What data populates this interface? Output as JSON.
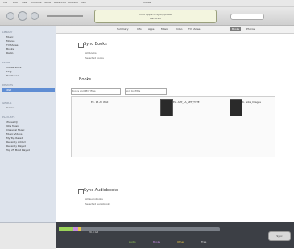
{
  "menubar": {
    "items": [
      "File",
      "Edit",
      "View",
      "Controls",
      "Store",
      "Advanced",
      "Window",
      "Help"
    ]
  },
  "window": {
    "title": "iTunes"
  },
  "toolbar": {
    "lcd_line1": "Click apple to sync/update",
    "lcd_line2": "Mac OS X"
  },
  "tabs": [
    {
      "label": "Summary"
    },
    {
      "label": "Info"
    },
    {
      "label": "Apps"
    },
    {
      "label": "Music"
    },
    {
      "label": "Video"
    },
    {
      "label": "TV Shows"
    },
    {
      "label": "Books",
      "active": true
    },
    {
      "label": "Photos"
    }
  ],
  "sidebar": {
    "sections": [
      {
        "head": "LIBRARY",
        "items": [
          "Music",
          "Movies",
          "TV Shows",
          "Books",
          "Radio"
        ]
      },
      {
        "head": "STORE",
        "items": [
          "iTunes Store",
          "Ping",
          "Purchased"
        ]
      },
      {
        "head": "DEVICES",
        "items": [
          "iPad"
        ]
      },
      {
        "head": "GENIUS",
        "items": [
          "Genius"
        ]
      },
      {
        "head": "PLAYLISTS",
        "items": [
          "iTunes DJ",
          "90's Music",
          "Classical Music",
          "Music Videos",
          "My Top Rated",
          "Recently Added",
          "Recently Played",
          "Top 25 Most Played"
        ]
      }
    ]
  },
  "main": {
    "sync_books_label": "Sync Books",
    "all_books": "All books",
    "selected_books": "Selected books",
    "books_header": "Books",
    "sort_option": "Books and PDF files",
    "sort_by": "Sort by Title",
    "book_items": [
      "Ex. 15 All Well",
      "Ex. APP_LA_SET_TYPE",
      "K. Gibs_Images"
    ],
    "audiobooks_label": "Sync Audiobooks",
    "all_audiobooks": "All audiobooks",
    "selected_audiobooks": "Selected audiobooks"
  },
  "bottombar": {
    "capacity_label": "Capacity",
    "capacity_value": "29.8 GB",
    "legend": [
      "Audio",
      "Books",
      "Other",
      "Free"
    ],
    "sync_label": "Sync"
  }
}
